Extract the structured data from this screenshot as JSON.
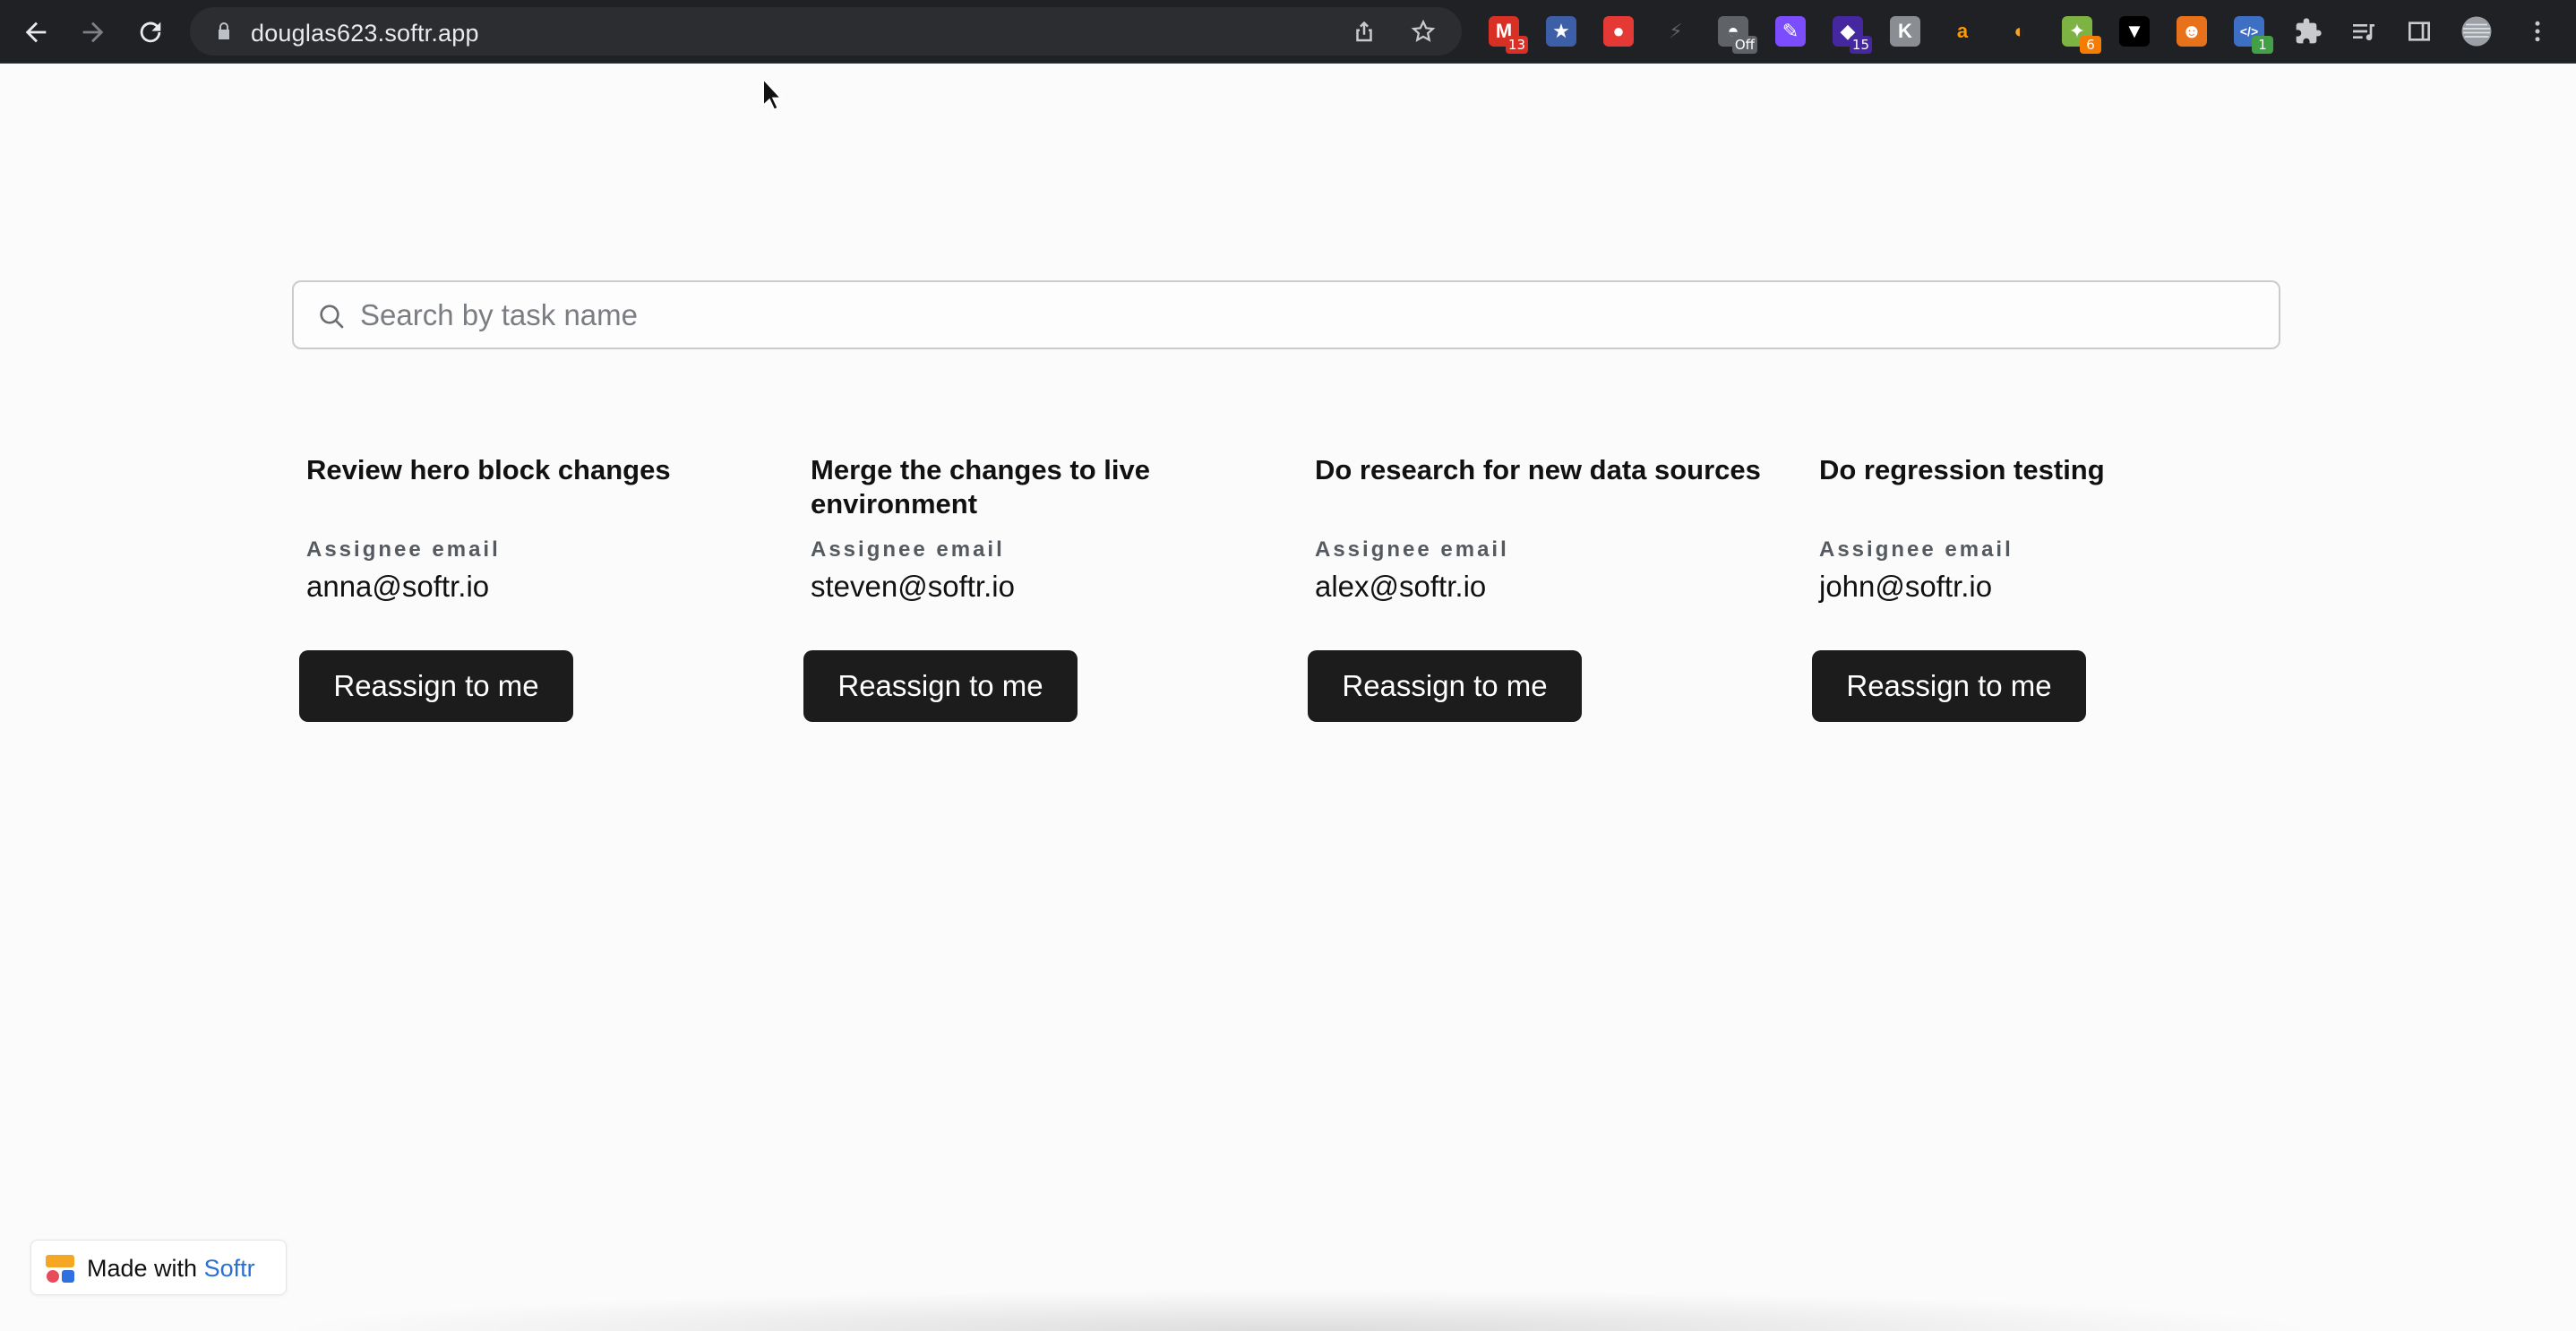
{
  "browser": {
    "url": "douglas623.softr.app",
    "extensions": [
      {
        "icon": "gmail-icon",
        "glyph": "M",
        "bg": "#d93025",
        "badge": "13",
        "badge_color": "#d93025"
      },
      {
        "icon": "star-bookmark-icon",
        "glyph": "★",
        "bg": "#3c5fa8",
        "badge": "",
        "badge_color": ""
      },
      {
        "icon": "red-app-icon",
        "glyph": "●",
        "bg": "#e53935",
        "badge": "",
        "badge_color": ""
      },
      {
        "icon": "bolt-icon",
        "glyph": "⚡",
        "bg": "#202124",
        "badge": "",
        "badge_color": ""
      },
      {
        "icon": "hat-icon",
        "glyph": "◓",
        "bg": "#5f6368",
        "badge": "Off",
        "badge_color": "#5f6368"
      },
      {
        "icon": "feather-icon",
        "glyph": "✎",
        "bg": "#7c4dff",
        "badge": "",
        "badge_color": ""
      },
      {
        "icon": "diamond-icon",
        "glyph": "◆",
        "bg": "#4527a0",
        "badge": "15",
        "badge_color": "#4527a0"
      },
      {
        "icon": "k-icon",
        "glyph": "K",
        "bg": "#8a8d91",
        "badge": "",
        "badge_color": ""
      },
      {
        "icon": "amazon-icon",
        "glyph": "a",
        "bg": "#202124",
        "badge": "",
        "badge_color": ""
      },
      {
        "icon": "crescent-icon",
        "glyph": "◐",
        "bg": "#202124",
        "badge": "",
        "badge_color": ""
      },
      {
        "icon": "bulb-icon",
        "glyph": "✦",
        "bg": "#7cb342",
        "badge": "6",
        "badge_color": "#f57c00"
      },
      {
        "icon": "mask-icon",
        "glyph": "▼",
        "bg": "#000000",
        "badge": "",
        "badge_color": ""
      },
      {
        "icon": "robot-icon",
        "glyph": "☻",
        "bg": "#e8711c",
        "badge": "",
        "badge_color": ""
      },
      {
        "icon": "code-icon",
        "glyph": "</>",
        "bg": "#3d6fc4",
        "badge": "1",
        "badge_color": "#43a047"
      }
    ]
  },
  "search": {
    "placeholder": "Search by task name",
    "value": ""
  },
  "tasks": [
    {
      "title": "Review hero block changes",
      "label": "Assignee email",
      "email": "anna@softr.io",
      "button": "Reassign to me"
    },
    {
      "title": "Merge the changes to live environment",
      "label": "Assignee email",
      "email": "steven@softr.io",
      "button": "Reassign to me"
    },
    {
      "title": "Do research for new data sources",
      "label": "Assignee email",
      "email": "alex@softr.io",
      "button": "Reassign to me"
    },
    {
      "title": "Do regression testing",
      "label": "Assignee email",
      "email": "john@softr.io",
      "button": "Reassign to me"
    }
  ],
  "footer": {
    "made_with": "Made with",
    "brand": "Softr"
  }
}
